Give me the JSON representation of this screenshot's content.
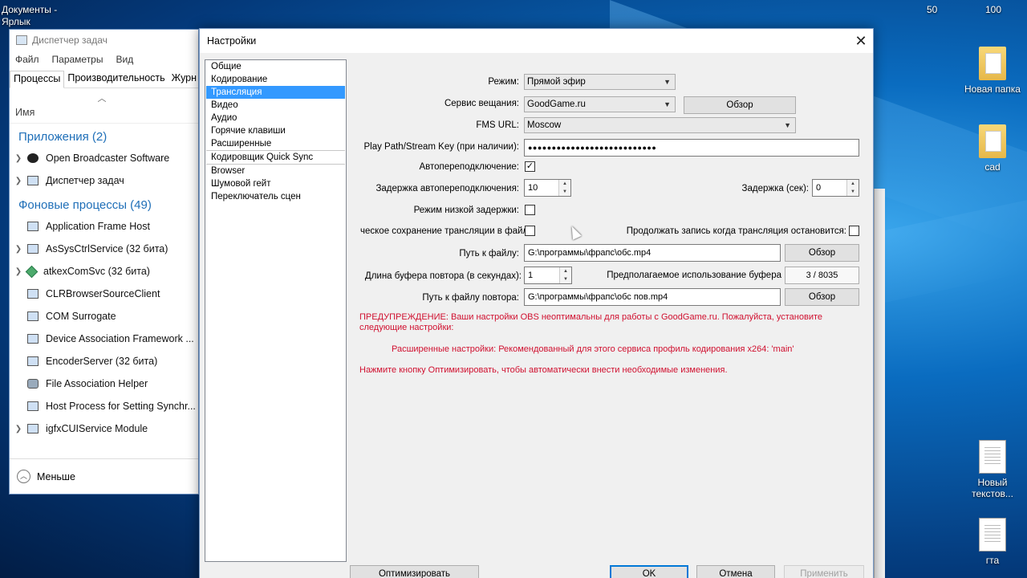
{
  "desktop": {
    "top_left_label_line1": "Документы -",
    "top_left_label_line2": "Ярлык",
    "top_numbers": [
      "50",
      "100"
    ],
    "icons": [
      {
        "label": "Новая папка",
        "icon": "folder-icon"
      },
      {
        "label": "cad",
        "icon": "folder-icon"
      },
      {
        "label": "Новый текстов...",
        "icon": "text-document-icon"
      },
      {
        "label": "гта",
        "icon": "text-document-icon"
      }
    ]
  },
  "taskmanager": {
    "title": "Диспетчер задач",
    "menu": [
      "Файл",
      "Параметры",
      "Вид"
    ],
    "tabs": [
      "Процессы",
      "Производительность",
      "Журн"
    ],
    "column_name": "Имя",
    "apps_group": "Приложения (2)",
    "apps": [
      {
        "name": "Open Broadcaster Software",
        "icon": "obs-icon"
      },
      {
        "name": "Диспетчер задач",
        "icon": "taskmanager-icon"
      }
    ],
    "bg_group": "Фоновые процессы (49)",
    "bg": [
      {
        "name": "Application Frame Host",
        "expand": false
      },
      {
        "name": "AsSysCtrlService (32 бита)",
        "expand": true
      },
      {
        "name": "atkexComSvc (32 бита)",
        "expand": true
      },
      {
        "name": "CLRBrowserSourceClient",
        "expand": false
      },
      {
        "name": "COM Surrogate",
        "expand": false
      },
      {
        "name": "Device Association Framework ...",
        "expand": false
      },
      {
        "name": "EncoderServer (32 бита)",
        "expand": false
      },
      {
        "name": "File Association Helper",
        "expand": false
      },
      {
        "name": "Host Process for Setting Synchr...",
        "expand": false
      },
      {
        "name": "igfxCUIService Module",
        "expand": true
      }
    ],
    "fewer": "Меньше"
  },
  "settings": {
    "title": "Настройки",
    "nav": [
      "Общие",
      "Кодирование",
      "Трансляция",
      "Видео",
      "Аудио",
      "Горячие клавиши",
      "Расширенные",
      "Кодировщик Quick Sync",
      "Browser",
      "Шумовой гейт",
      "Переключатель сцен"
    ],
    "nav_selected": "Трансляция",
    "mode_label": "Режим:",
    "mode_value": "Прямой эфир",
    "service_label": "Сервис вещания:",
    "service_value": "GoodGame.ru",
    "browse": "Обзор",
    "fms_label": "FMS URL:",
    "fms_value": "Moscow",
    "key_label": "Play Path/Stream Key (при наличии):",
    "key_value": "●●●●●●●●●●●●●●●●●●●●●●●●●●●",
    "autoreconnect_label": "Автопереподключение:",
    "autoreconnect_checked": true,
    "reconnect_delay_label": "Задержка автопереподключения:",
    "reconnect_delay_value": "10",
    "delay_label": "Задержка (сек):",
    "delay_value": "0",
    "lowlatency_label": "Режим низкой задержки:",
    "save_label": "ческое сохранение трансляции в файл:",
    "continue_label": "Продолжать запись когда трансляция остановится:",
    "path_label": "Путь к файлу:",
    "path_value": "G:\\программы\\фрапс\\обс.mp4",
    "replay_label": "Длина буфера повтора (в секундах):",
    "replay_value": "1",
    "buffer_label": "Предполагаемое использование буфера",
    "buffer_value": "3 / 8035",
    "replay_path_label": "Путь к файлу повтора:",
    "replay_path_value": "G:\\программы\\фрапс\\обс пов.mp4",
    "warning1": "ПРЕДУПРЕЖДЕНИЕ: Ваши настройки OBS неоптимальны для работы с GoodGame.ru. Пожалуйста, установите следующие настройки:",
    "warning2": "Расширенные настройки: Рекомендованный для этого сервиса профиль кодирования x264: 'main'",
    "warning3": "Нажмите кнопку Оптимизировать, чтобы автоматически внести необходимые изменения.",
    "optimize": "Оптимизировать",
    "ok": "OK",
    "cancel": "Отмена",
    "apply": "Применить"
  }
}
